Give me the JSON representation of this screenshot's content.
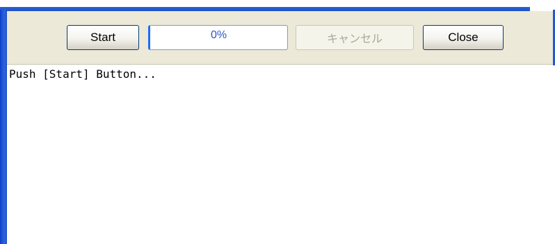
{
  "toolbar": {
    "start_label": "Start",
    "progress_text": "0%",
    "progress_value": 0,
    "cancel_label": "キャンセル",
    "cancel_disabled": true,
    "close_label": "Close"
  },
  "output": {
    "text": "Push [Start] Button..."
  },
  "colors": {
    "toolbar_bg": "#ece9d8",
    "frame_blue": "#1d55d8",
    "progress_text": "#2b55c8",
    "disabled_text": "#aca899"
  }
}
